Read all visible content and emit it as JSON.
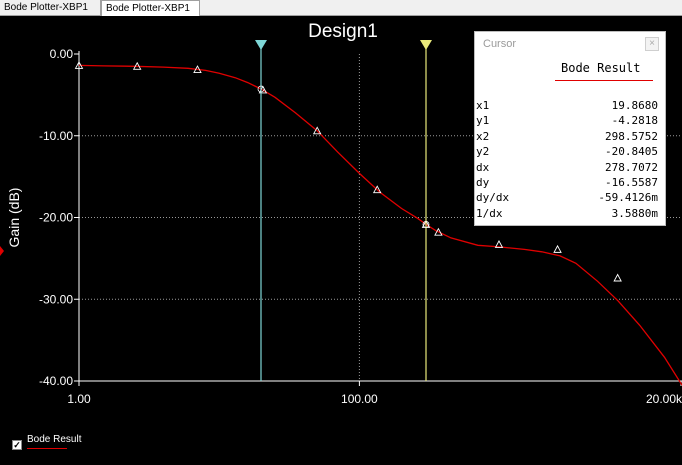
{
  "tabs": [
    {
      "label": "Bode Plotter-XBP1"
    },
    {
      "label": "Bode Plotter-XBP1"
    }
  ],
  "cursor_panel": {
    "title": "Cursor",
    "close_label": "×",
    "header": "Bode Result",
    "rows": [
      {
        "key": "x1",
        "value": "19.8680"
      },
      {
        "key": "y1",
        "value": "-4.2818"
      },
      {
        "key": "x2",
        "value": "298.5752"
      },
      {
        "key": "y2",
        "value": "-20.8405"
      },
      {
        "key": "dx",
        "value": "278.7072"
      },
      {
        "key": "dy",
        "value": "-16.5587"
      },
      {
        "key": "dy/dx",
        "value": "-59.4126m"
      },
      {
        "key": "1/dx",
        "value": "3.5880m"
      }
    ]
  },
  "legend": {
    "label": "Bode Result",
    "checked": true,
    "check_glyph": "✓"
  },
  "chart_data": {
    "type": "line",
    "title": "Design1",
    "ylabel": "Gain (dB)",
    "xscale": "log",
    "xlim": [
      1,
      20000
    ],
    "ylim": [
      -40,
      0
    ],
    "x_tick_values": [
      1,
      100,
      20000
    ],
    "x_tick_labels": [
      "1.00",
      "100.00",
      "20.00k"
    ],
    "y_tick_values": [
      0,
      -10,
      -20,
      -30,
      -40
    ],
    "y_tick_labels": [
      "0.00",
      "-10.00",
      "-20.00",
      "-30.00",
      "-40.00"
    ],
    "grid": true,
    "series": [
      {
        "name": "Bode Result",
        "color": "#e00000",
        "x": [
          1,
          1.5,
          2.5,
          4,
          6,
          8,
          10,
          13,
          16,
          19.868,
          25,
          35,
          50,
          70,
          100,
          140,
          200,
          260,
          298.5752,
          350,
          450,
          700,
          1000,
          1500,
          2000,
          2700,
          3500,
          5000,
          7000,
          10000,
          15000,
          20000
        ],
        "y": [
          -1.4,
          -1.45,
          -1.5,
          -1.6,
          -1.75,
          -2.0,
          -2.35,
          -2.9,
          -3.5,
          -4.2818,
          -5.3,
          -7.2,
          -9.4,
          -12.0,
          -14.6,
          -16.9,
          -18.9,
          -20.1,
          -20.8405,
          -21.6,
          -22.5,
          -23.4,
          -23.6,
          -23.9,
          -24.2,
          -24.7,
          -25.6,
          -27.8,
          -30.2,
          -33.2,
          -37.1,
          -40.5
        ]
      }
    ],
    "markers": [
      {
        "x": 1.0,
        "y": -1.4
      },
      {
        "x": 2.6,
        "y": -1.5
      },
      {
        "x": 7.0,
        "y": -1.9
      },
      {
        "x": 20.5,
        "y": -4.4
      },
      {
        "x": 50,
        "y": -9.4
      },
      {
        "x": 134,
        "y": -16.6
      },
      {
        "x": 298.5752,
        "y": -20.8405
      },
      {
        "x": 366,
        "y": -21.8
      },
      {
        "x": 990,
        "y": -23.3
      },
      {
        "x": 2590,
        "y": -23.9
      },
      {
        "x": 6950,
        "y": -27.4
      }
    ],
    "cursors": [
      {
        "x": 19.868,
        "color": "#7fd7d7"
      },
      {
        "x": 298.5752,
        "color": "#e8e87a"
      }
    ]
  }
}
